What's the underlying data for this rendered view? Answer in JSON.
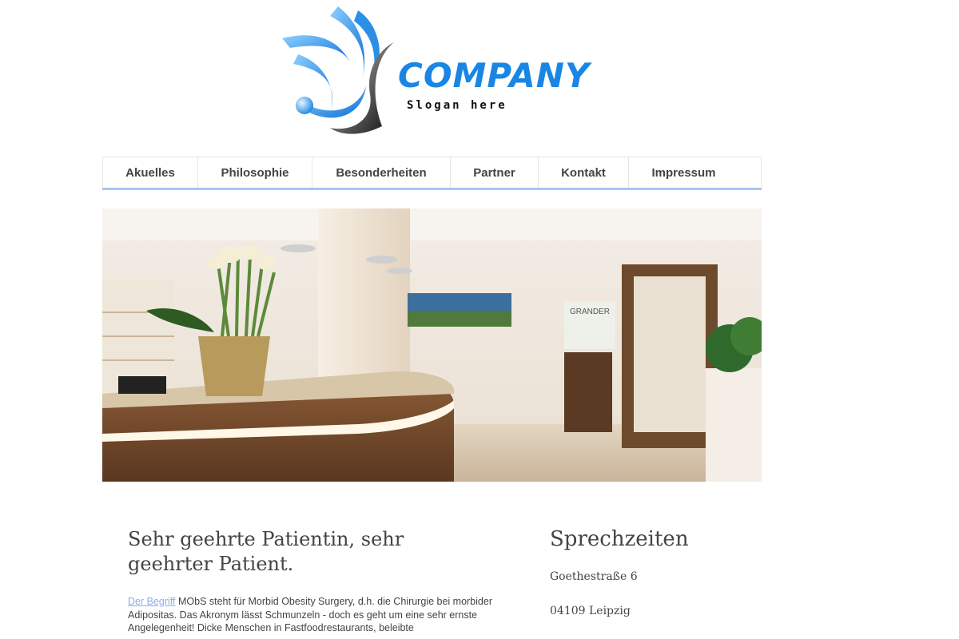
{
  "logo": {
    "wordmark": "COMPANY",
    "slogan": "Slogan here",
    "brand_color": "#1a86e4"
  },
  "nav": {
    "items": [
      {
        "label": "Akuelles"
      },
      {
        "label": "Philosophie"
      },
      {
        "label": "Besonderheiten"
      },
      {
        "label": "Partner"
      },
      {
        "label": "Kontakt"
      },
      {
        "label": "Impressum"
      }
    ],
    "underline_color": "#a9c4f0"
  },
  "hero": {
    "panel_sign": "GRANDER"
  },
  "main": {
    "heading": "Sehr geehrte Patientin, sehr geehrter Patient.",
    "intro_link": "Der Begriff",
    "intro_text": " MObS steht für Morbid Obesity Surgery, d.h. die Chirurgie bei morbider Adipositas. Das Akronym lässt Schmunzeln - doch es geht um eine sehr ernste Angelegenheit! Dicke Menschen in Fastfoodrestaurants, beleibte"
  },
  "sidebar": {
    "heading": "Sprechzeiten",
    "address_street": "Goethestraße 6",
    "address_city": "04109 Leipzig"
  }
}
